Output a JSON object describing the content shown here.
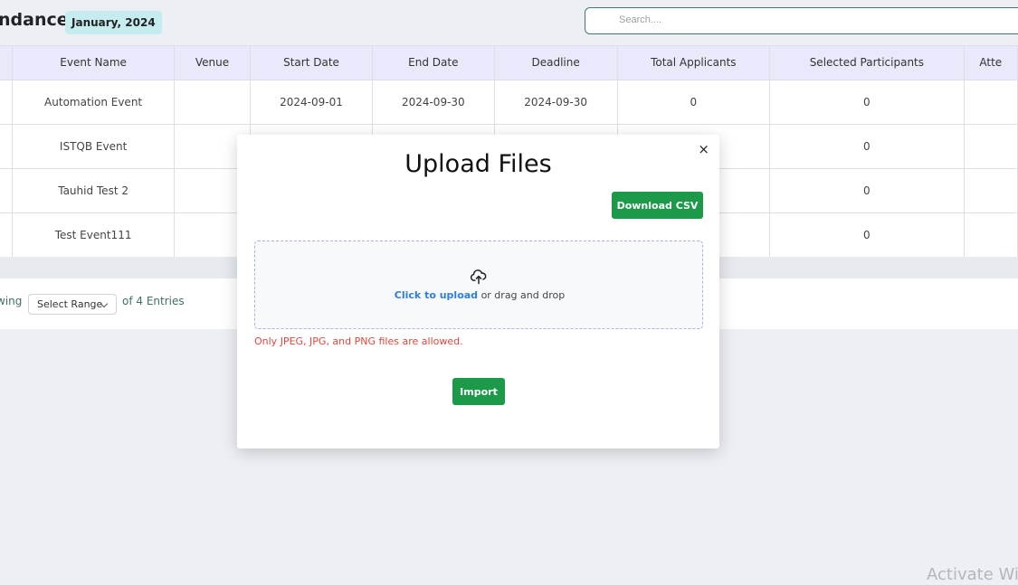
{
  "header": {
    "title": "ndance",
    "month_badge": "January, 2024",
    "search_placeholder": "Search...."
  },
  "table": {
    "columns": [
      "",
      "Event Name",
      "Venue",
      "Start Date",
      "End Date",
      "Deadline",
      "Total Applicants",
      "Selected Participants",
      "Atte"
    ],
    "rows": [
      [
        "",
        "Automation Event",
        "",
        "2024-09-01",
        "2024-09-30",
        "2024-09-30",
        "0",
        "0",
        ""
      ],
      [
        "",
        "ISTQB Event",
        "",
        "",
        "",
        "",
        "",
        "0",
        ""
      ],
      [
        "",
        "Tauhid Test 2",
        "",
        "",
        "",
        "",
        "",
        "0",
        ""
      ],
      [
        "",
        "Test Event111",
        "",
        "",
        "",
        "",
        "",
        "0",
        ""
      ]
    ]
  },
  "pagination": {
    "showing_label": "wing",
    "range_select": "Select Range",
    "entries_label": "of 4 Entries"
  },
  "modal": {
    "title": "Upload Files",
    "close_symbol": "×",
    "download_button": "Download CSV",
    "click_to_upload": "Click to upload",
    "drag_text": "or drag and drop",
    "file_hint": "Only JPEG, JPG, and PNG files are allowed.",
    "import_button": "Import"
  },
  "watermark": "Activate Wi",
  "colors": {
    "accent_green": "#1c9a4a",
    "header_bg": "#e8e9fb",
    "link_blue": "#2f7fd9",
    "error_red": "#e0463c"
  }
}
